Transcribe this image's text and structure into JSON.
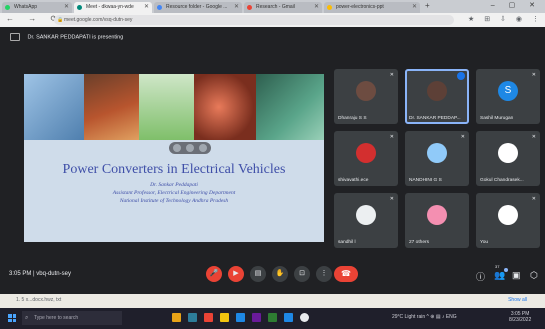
{
  "browser": {
    "tabs": [
      {
        "label": "WhatsApp",
        "color": "#25d366",
        "active": false
      },
      {
        "label": "Meet - dkwaa-yn-wde",
        "color": "#00897b",
        "active": true
      },
      {
        "label": "Resource folder - Google ...",
        "color": "#4285f4",
        "active": false
      },
      {
        "label": "Research - Gmail",
        "color": "#ea4335",
        "active": false
      },
      {
        "label": "power-electronics-ppt",
        "color": "#fbbc04",
        "active": false
      }
    ],
    "new_tab": "+",
    "window_controls": "– ▢ ✕",
    "nav_icons": "← → ⟳ ⌂",
    "address": "meet.google.com/vsq-dutn-sey",
    "extension_icons": "★ ⊞ ⇩ ◉ ⋮"
  },
  "meet": {
    "presenting_text": "Dr. SANKAR PEDDAPATI is presenting",
    "slide": {
      "title": "Power Converters in Electrical Vehicles",
      "author": "Dr. Sankar Peddapati",
      "position": "Assistant Professor, Electrical Engineering Department",
      "institute": "National Institute of Technology Andhra Pradesh"
    },
    "participants": [
      {
        "name": "Dhanraju S S",
        "avatar_color": "#6d4c41",
        "muted": true,
        "speaking": false
      },
      {
        "name": "Dr. SANKAR PEDDAP...",
        "avatar_color": "#5d4037",
        "muted": false,
        "speaking": true
      },
      {
        "name": "Sashil Murugan",
        "avatar_color": "#1e88e5",
        "avatar_letter": "S",
        "muted": true,
        "speaking": false
      },
      {
        "name": "shivavathi.ece",
        "avatar_color": "#d32f2f",
        "muted": true,
        "speaking": false
      },
      {
        "name": "NANDHINI G S",
        "avatar_color": "#90caf9",
        "muted": true,
        "speaking": false
      },
      {
        "name": "Gokul Chandrasek...",
        "avatar_color": "#ffffff",
        "muted": true,
        "speaking": false
      },
      {
        "name": "sandhil l",
        "avatar_color": "#eceff1",
        "muted": true,
        "speaking": false
      },
      {
        "name": "27 others",
        "avatar_color": "#f48fb1",
        "muted": false,
        "speaking": false
      },
      {
        "name": "You",
        "avatar_color": "#ffffff",
        "muted": true,
        "speaking": false
      }
    ],
    "time": "3:05 PM",
    "meeting_code": "vbq-dutn-sey",
    "controls": [
      "mic-off",
      "camera-off",
      "captions",
      "raise-hand",
      "present",
      "more",
      "end-call"
    ],
    "right_controls": [
      "info",
      "people",
      "chat",
      "activities"
    ],
    "people_count": "37"
  },
  "downloads": {
    "item": "1. 5 x...docx.hwz, txt",
    "show_all": "Show all"
  },
  "taskbar": {
    "search_placeholder": "Type here to search",
    "apps": [
      "#e8a317",
      "#2d7d9a",
      "#ea4335",
      "#f1c40f",
      "#1e88e5",
      "#6a1b9a",
      "#2e7d32",
      "#1e88e5",
      "#e8eaed"
    ],
    "weather": "29°C Light rain",
    "tray_icons": "^ ⊕ ▤ ♪ ENG",
    "time": "3:05 PM",
    "date": "8/23/2022"
  }
}
